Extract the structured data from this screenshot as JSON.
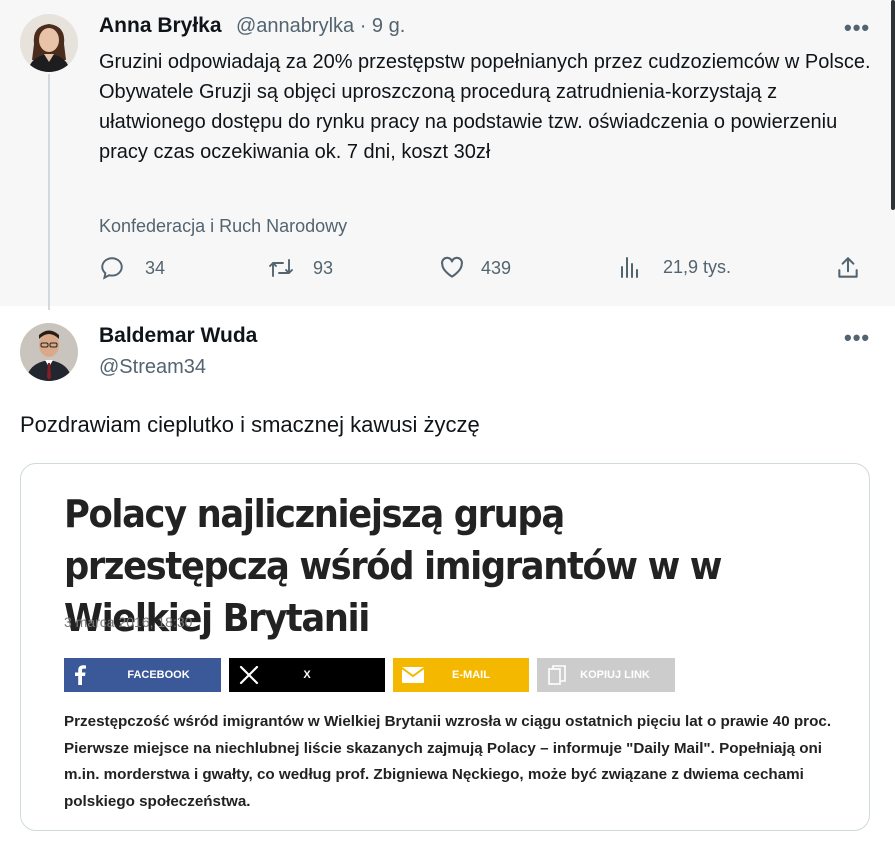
{
  "tweet1": {
    "name": "Anna Bryłka",
    "handle": "@annabrylka · 9 g.",
    "text": "Gruzini odpowiadają za 20% przestępstw popełnianych przez cudzoziemców w Polsce. Obywatele Gruzji są objęci uproszczoną procedurą zatrudnienia-korzystają z ułatwionego dostępu do rynku pracy na podstawie tzw. oświadczenia o powierzeniu pracy czas oczekiwania ok. 7 dni, koszt 30zł",
    "affiliation": "Konfederacja i Ruch Narodowy",
    "actions": {
      "replies": "34",
      "retweets": "93",
      "likes": "439",
      "views": "21,9 tys."
    },
    "more": "•••"
  },
  "tweet2": {
    "name": "Baldemar Wuda",
    "handle": "@Stream34",
    "text": "Pozdrawiam cieplutko i smacznej kawusi życzę",
    "more": "•••"
  },
  "card": {
    "headline": "Polacy najliczniejszą grupą przestępczą wśród imigrantów w w Wielkiej Brytanii",
    "date": "3 marca 2016, 18:30",
    "share": {
      "facebook": "FACEBOOK",
      "x": "X",
      "email": "E-MAIL",
      "copy": "KOPIUJ LINK"
    },
    "lead": "Przestępczość wśród imigrantów w Wielkiej Brytanii wzrosła w ciągu ostatnich pięciu lat o prawie 40 proc. Pierwsze miejsce na niechlubnej liście skazanych zajmują Polacy – informuje \"Daily Mail\". Popełniają oni m.in. morderstwa i gwałty, co według prof. Zbigniewa Nęckiego, może być związane z dwiema cechami polskiego społeczeństwa."
  },
  "colors": {
    "facebook": "#3b5998",
    "x": "#000000",
    "email": "#f5b800",
    "copy": "#cccccc",
    "muted": "#536471"
  }
}
